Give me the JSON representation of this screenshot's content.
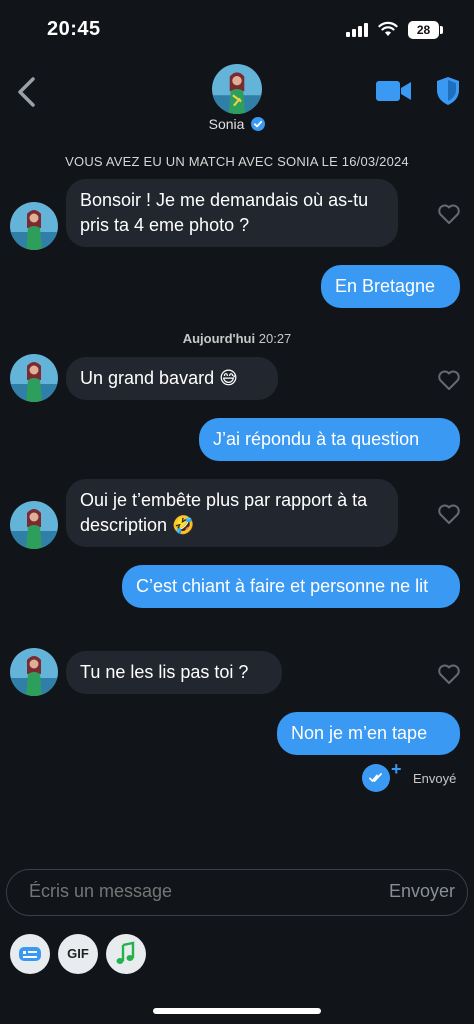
{
  "status": {
    "time": "20:45",
    "battery": "28"
  },
  "header": {
    "name": "Sonia"
  },
  "match_banner": "VOUS AVEZ EU UN MATCH AVEC SONIA LE 16/03/2024",
  "day_separator": {
    "day": "Aujourd'hui",
    "time": "20:27"
  },
  "messages": [
    {
      "text": "Bonsoir ! Je me demandais où as-tu pris ta 4 eme photo ?"
    },
    {
      "text": "En Bretagne"
    },
    {
      "text": "Un grand bavard 😅"
    },
    {
      "text": "J’ai répondu à ta question"
    },
    {
      "text": "Oui je t’embête plus par rapport à ta description 🤣"
    },
    {
      "text": "C’est chiant à faire et personne ne lit"
    },
    {
      "text": "Tu ne les lis pas toi ?"
    },
    {
      "text": "Non je m’en tape"
    }
  ],
  "sent_status": "Envoyé",
  "composer": {
    "placeholder": "Écris un message",
    "send_label": "Envoyer"
  },
  "toolbar": {
    "gif_label": "GIF"
  },
  "colors": {
    "accent": "#3a99f2",
    "background": "#111418",
    "incoming_bubble": "#22262e"
  }
}
